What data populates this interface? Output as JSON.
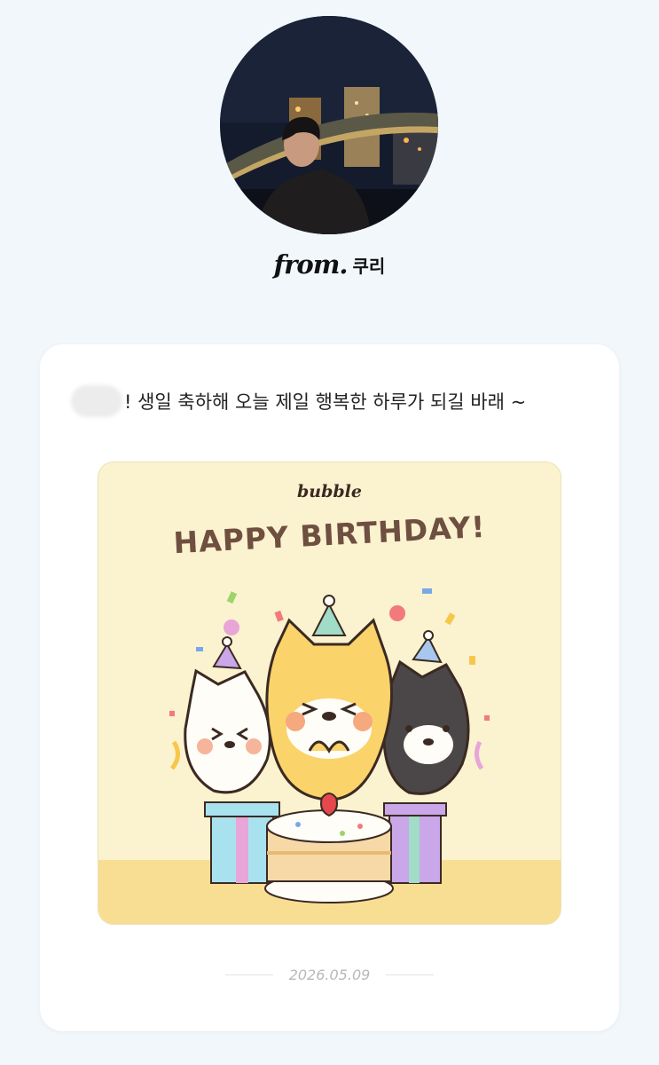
{
  "header": {
    "from_prefix": "from.",
    "sender_name": "쿠리"
  },
  "message": {
    "text": "! 생일 축하해 오늘 제일 행복한 하루가 되길 바래 ~"
  },
  "sticker": {
    "brand": "bubble",
    "title": "HAPPY BIRTHDAY!"
  },
  "footer": {
    "date": "2026.05.09"
  },
  "colors": {
    "page_background": "#f1f7fb",
    "card_background": "#ffffff",
    "sticker_background": "#fbf2cf",
    "sticker_title": "#6e4f40"
  }
}
